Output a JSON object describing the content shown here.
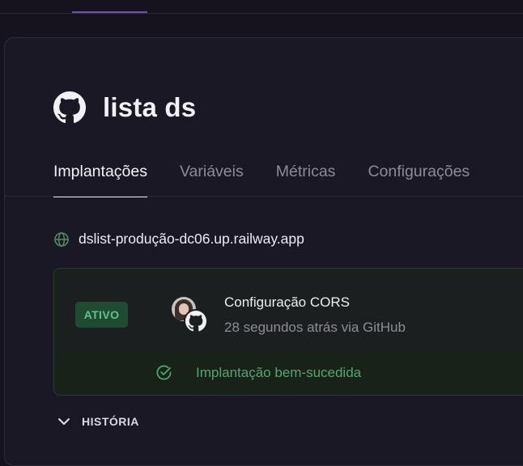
{
  "project": {
    "title": "lista ds",
    "icon": "github-icon"
  },
  "tabs": [
    {
      "label": "Implantações",
      "active": true
    },
    {
      "label": "Variáveis",
      "active": false
    },
    {
      "label": "Métricas",
      "active": false
    },
    {
      "label": "Configurações",
      "active": false
    }
  ],
  "service": {
    "url": "dslist-produção-dc06.up.railway.app",
    "icon": "globe-icon"
  },
  "deployment": {
    "badge": "ATIVO",
    "commit_title": "Configuração CORS",
    "commit_meta": "28 segundos atrás via GitHub",
    "status": "Implantação bem-sucedida",
    "status_icon": "check-circle-icon"
  },
  "history": {
    "label": "HISTÓRIA",
    "icon": "chevron-down-icon"
  },
  "colors": {
    "background": "#16131f",
    "accent": "#6d4ec2",
    "success": "#4fa86f",
    "badge_bg": "#1f4b33"
  }
}
